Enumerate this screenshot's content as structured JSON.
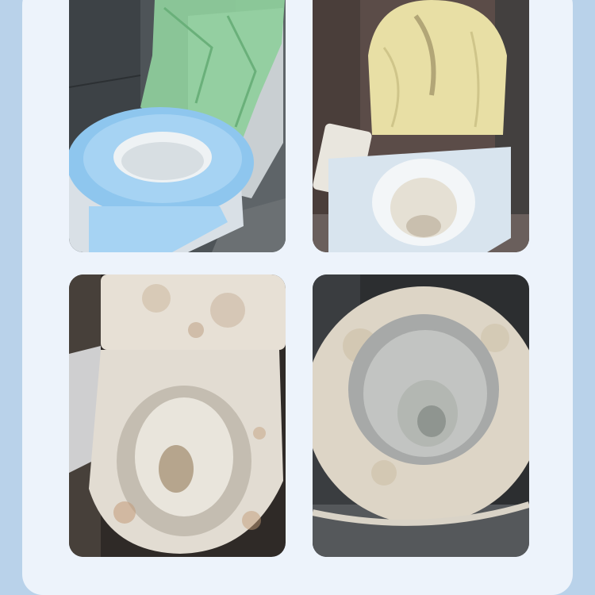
{
  "gallery": {
    "background_color": "#b9d2ea",
    "panel_color": "#edf3fb",
    "photos": [
      {
        "subject": "toilet-with-blue-fabric-seat-cover-and-green-bag"
      },
      {
        "subject": "smart-toilet-with-paper-seat-cover-and-yellow-bag"
      },
      {
        "subject": "dirty-toilet-seat-stained"
      },
      {
        "subject": "stained-toilet-bowl-closeup"
      }
    ]
  }
}
